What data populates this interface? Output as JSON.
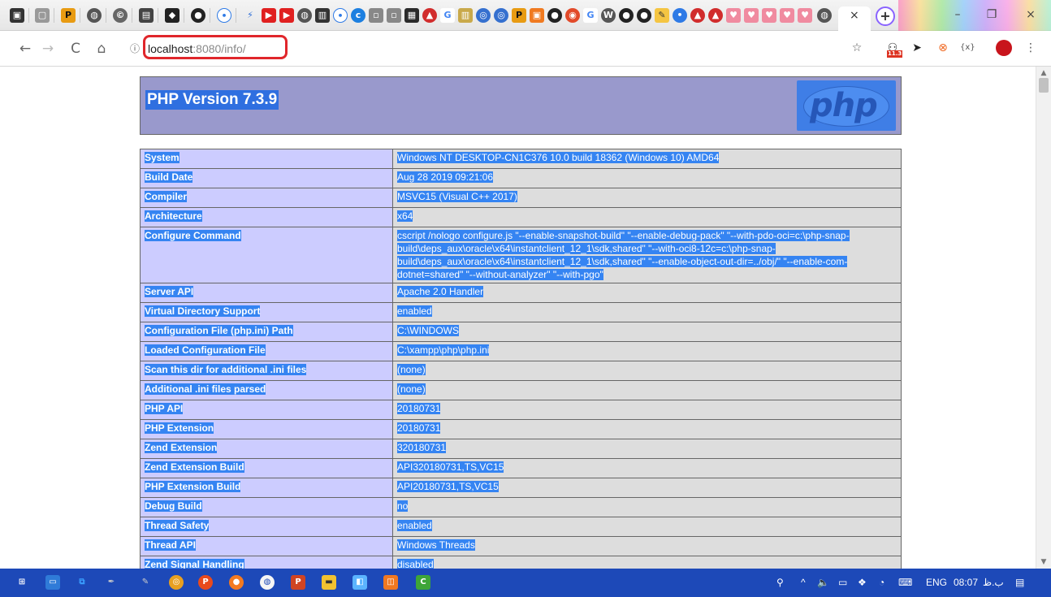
{
  "browser": {
    "tab_close": "×",
    "new_tab": "+",
    "url_host": "localhost",
    "url_rest": ":8080/info/",
    "window": {
      "minimize": "–",
      "maximize": "❐",
      "close": "×"
    },
    "nav": {
      "back": "←",
      "forward": "→",
      "reload": "C",
      "home": "⌂",
      "info": "ⓘ"
    },
    "toolbar_icons": {
      "star": "☆",
      "ext_badge": "11.3",
      "menu": "⋮",
      "ext_text": "{x}"
    }
  },
  "page": {
    "title": "PHP Version 7.3.9",
    "logo_text": "php",
    "rows": [
      {
        "label": "System",
        "value": "Windows NT DESKTOP-CN1C376 10.0 build 18362 (Windows 10) AMD64"
      },
      {
        "label": "Build Date",
        "value": "Aug 28 2019 09:21:06"
      },
      {
        "label": "Compiler",
        "value": "MSVC15 (Visual C++ 2017)"
      },
      {
        "label": "Architecture",
        "value": "x64"
      },
      {
        "label": "Configure Command",
        "value_lines": [
          "cscript /nologo configure.js \"--enable-snapshot-build\" \"--enable-debug-pack\" \"--with-pdo-oci=c:\\php-snap-",
          "build\\deps_aux\\oracle\\x64\\instantclient_12_1\\sdk,shared\" \"--with-oci8-12c=c:\\php-snap-",
          "build\\deps_aux\\oracle\\x64\\instantclient_12_1\\sdk,shared\" \"--enable-object-out-dir=../obj/\" \"--enable-com-",
          "dotnet=shared\" \"--without-analyzer\" \"--with-pgo\""
        ]
      },
      {
        "label": "Server API",
        "value": "Apache 2.0 Handler"
      },
      {
        "label": "Virtual Directory Support",
        "value": "enabled"
      },
      {
        "label": "Configuration File (php.ini) Path",
        "value": "C:\\WINDOWS"
      },
      {
        "label": "Loaded Configuration File",
        "value": "C:\\xampp\\php\\php.ini"
      },
      {
        "label": "Scan this dir for additional .ini files",
        "value": "(none)"
      },
      {
        "label": "Additional .ini files parsed",
        "value": "(none)"
      },
      {
        "label": "PHP API",
        "value": "20180731"
      },
      {
        "label": "PHP Extension",
        "value": "20180731"
      },
      {
        "label": "Zend Extension",
        "value": "320180731"
      },
      {
        "label": "Zend Extension Build",
        "value": "API320180731,TS,VC15"
      },
      {
        "label": "PHP Extension Build",
        "value": "API20180731,TS,VC15"
      },
      {
        "label": "Debug Build",
        "value": "no"
      },
      {
        "label": "Thread Safety",
        "value": "enabled"
      },
      {
        "label": "Thread API",
        "value": "Windows Threads"
      },
      {
        "label": "Zend Signal Handling",
        "value": "disabled"
      }
    ]
  },
  "taskbar": {
    "language": "ENG",
    "time": "08:07",
    "period": "ب.ظ"
  },
  "colors": {
    "selection": "#3584f2",
    "header_bg": "#9999cc",
    "label_bg": "#ccccff",
    "value_bg": "#dddddd",
    "taskbar": "#1d49b8",
    "url_highlight": "#e0262b"
  }
}
